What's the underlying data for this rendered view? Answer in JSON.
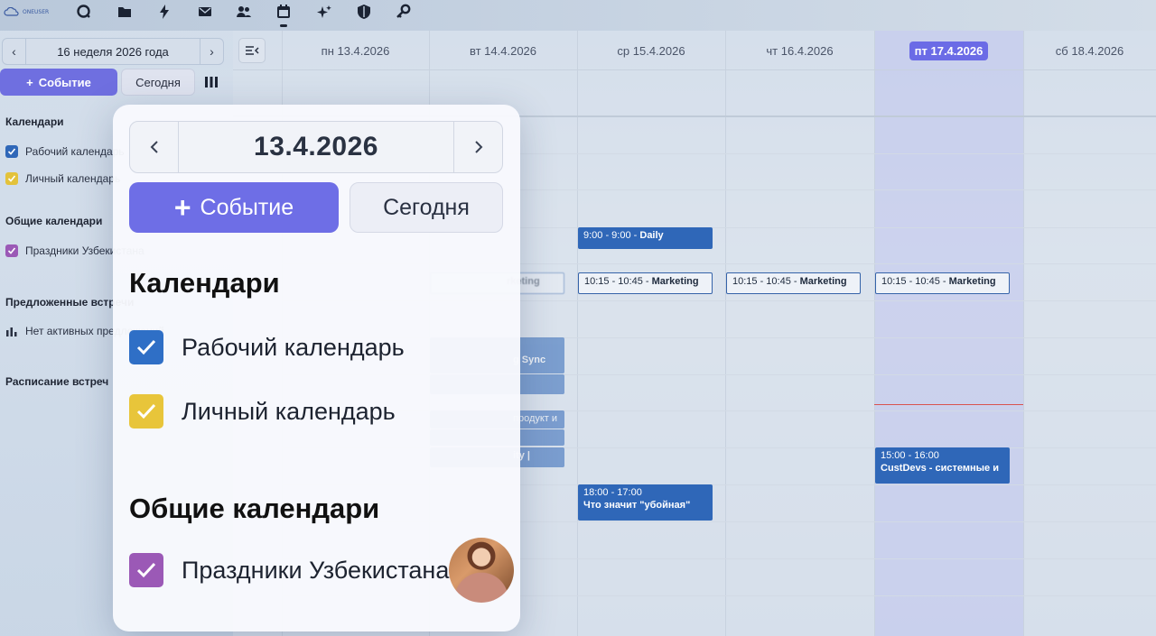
{
  "topbar": {
    "logo_text": "ONEUSER",
    "icons": [
      "search-icon",
      "folder-icon",
      "bolt-icon",
      "mail-icon",
      "users-icon",
      "calendar-icon",
      "sparkle-icon",
      "shield-icon",
      "key-icon"
    ]
  },
  "sidebar": {
    "week_label": "16 неделя 2026 года",
    "event_button": "Событие",
    "today_button": "Сегодня",
    "calendars_heading": "Календари",
    "calendars": [
      {
        "label": "Рабочий календарь",
        "color": "#2f67b8"
      },
      {
        "label": "Личный календарь",
        "color": "#e3c23b"
      }
    ],
    "shared_heading": "Общие календари",
    "shared": [
      {
        "label": "Праздники Узбекистана",
        "color": "#9b59b6"
      }
    ],
    "suggested_heading": "Предложенные встречи",
    "suggested_empty": "Нет активных предложений",
    "schedule_heading": "Расписание встреч"
  },
  "calendar": {
    "days": [
      {
        "label": "пн 13.4.2026",
        "today": false
      },
      {
        "label": "вт 14.4.2026",
        "today": false
      },
      {
        "label": "ср 15.4.2026",
        "today": false
      },
      {
        "label": "чт 16.4.2026",
        "today": false
      },
      {
        "label": "пт 17.4.2026",
        "today": true
      },
      {
        "label": "сб 18.4.2026",
        "today": false
      }
    ],
    "events": {
      "daily": {
        "time": "9:00 - 9:00",
        "name": "Daily"
      },
      "mkt_wed": {
        "time": "10:15 - 10:45",
        "name": "Marketing"
      },
      "mkt_thu": {
        "time": "10:15 - 10:45",
        "name": "Marketing"
      },
      "mkt_fri": {
        "time": "10:15 - 10:45",
        "name": "Marketing"
      },
      "mkt_tue_partial": "rketing",
      "sync_partial": "g Sync",
      "product_partial": "продукт и",
      "ity_partial": "ity |",
      "custdevs": {
        "time": "15:00 - 16:00",
        "name": "CustDevs - системные и"
      },
      "uboinaya": {
        "time": "18:00 - 17:00",
        "name": "Что значит \"убойная\""
      }
    }
  },
  "popover": {
    "date": "13.4.2026",
    "event_button": "Событие",
    "today_button": "Сегодня",
    "calendars_heading": "Календари",
    "calendars": [
      {
        "label": "Рабочий календарь",
        "color": "#2f6fc6"
      },
      {
        "label": "Личный календарь",
        "color": "#e8c53a"
      }
    ],
    "shared_heading": "Общие календари",
    "shared": [
      {
        "label": "Праздники Узбекистана",
        "color": "#9b59b6"
      }
    ]
  }
}
